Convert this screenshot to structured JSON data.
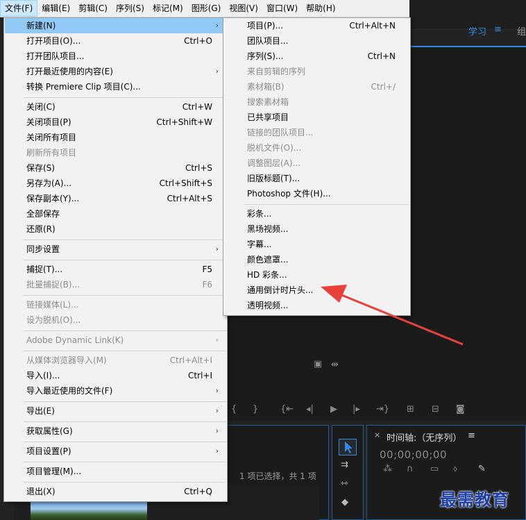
{
  "menubar": {
    "items": [
      "文件(F)",
      "编辑(E)",
      "剪辑(C)",
      "序列(S)",
      "标记(M)",
      "图形(G)",
      "视图(V)",
      "窗口(W)",
      "帮助(H)"
    ]
  },
  "workspace": {
    "learn": "学习",
    "menu_glyph": "≡",
    "group": "组"
  },
  "file_menu": {
    "new": "新建(N)",
    "open_project": {
      "label": "打开项目(O)...",
      "shortcut": "Ctrl+O"
    },
    "open_team_project": "打开团队项目...",
    "open_recent": "打开最近使用的内容(E)",
    "convert_clip": "转换 Premiere Clip 项目(C)...",
    "close": {
      "label": "关闭(C)",
      "shortcut": "Ctrl+W"
    },
    "close_project": {
      "label": "关闭项目(P)",
      "shortcut": "Ctrl+Shift+W"
    },
    "close_all": "关闭所有项目",
    "refresh_all": "刷新所有项目",
    "save": {
      "label": "保存(S)",
      "shortcut": "Ctrl+S"
    },
    "save_as": {
      "label": "另存为(A)...",
      "shortcut": "Ctrl+Shift+S"
    },
    "save_copy": {
      "label": "保存副本(Y)...",
      "shortcut": "Ctrl+Alt+S"
    },
    "save_all": "全部保存",
    "revert": "还原(R)",
    "sync_settings": "同步设置",
    "capture": {
      "label": "捕捉(T)...",
      "shortcut": "F5"
    },
    "batch_capture": {
      "label": "批量捕捉(B)...",
      "shortcut": "F6"
    },
    "link_media": "链接媒体(L)...",
    "make_offline": "设为脱机(O)...",
    "dynamic_link": "Adobe Dynamic Link(K)",
    "import_from_browser": {
      "label": "从媒体浏览器导入(M)",
      "shortcut": "Ctrl+Alt+I"
    },
    "import": {
      "label": "导入(I)...",
      "shortcut": "Ctrl+I"
    },
    "import_recent": "导入最近使用的文件(F)",
    "export": "导出(E)",
    "get_properties": "获取属性(G)",
    "project_settings": "项目设置(P)",
    "project_manager": "项目管理(M)...",
    "exit": {
      "label": "退出(X)",
      "shortcut": "Ctrl+Q"
    }
  },
  "new_submenu": {
    "project": {
      "label": "项目(P)...",
      "shortcut": "Ctrl+Alt+N"
    },
    "team_project": "团队项目...",
    "sequence": {
      "label": "序列(S)...",
      "shortcut": "Ctrl+N"
    },
    "seq_from_clip": "来自剪辑的序列",
    "bin": {
      "label": "素材箱(B)",
      "shortcut": "Ctrl+/"
    },
    "search_bin": "搜索素材箱",
    "shared_project": "已共享项目",
    "linked_team_project": "链接的团队项目...",
    "offline_file": "脱机文件(O)...",
    "adjustment_layer": "调整图层(A)...",
    "legacy_title": "旧版标题(T)...",
    "photoshop_file": "Photoshop 文件(H)...",
    "bars_tone": "彩条...",
    "black_video": "黑场视频...",
    "captions": "字幕...",
    "color_matte": "颜色遮罩...",
    "hd_bars": "HD 彩条...",
    "countdown": "通用倒计时片头...",
    "transparent_video": "透明视频..."
  },
  "timeline": {
    "close": "×",
    "title": "时间轴:（无序列）",
    "menu": "≡",
    "timecode": "00;00;00;00"
  },
  "project_panel": {
    "selection_info": "1 项已选择，共 1 项"
  },
  "watermark": "最需教育",
  "colors": {
    "highlight": "#91c9f7",
    "menubar_active": "#cce8ff",
    "accent_blue": "#2d8ceb",
    "arrow_red": "#e8413a",
    "watermark": "#1c3fa8"
  }
}
